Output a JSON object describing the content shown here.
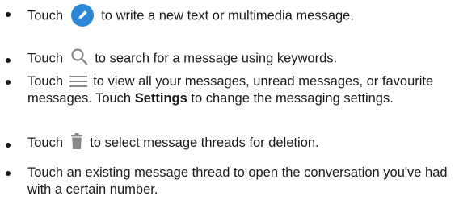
{
  "items": [
    {
      "prefix": "Touch",
      "icon": "compose-icon",
      "suffix": "to write a new text or multimedia message."
    },
    {
      "prefix": "Touch",
      "icon": "search-icon",
      "suffix": "to search for a message using keywords."
    },
    {
      "prefix": "Touch",
      "icon": "menu-icon",
      "suffix_a": "to view all your messages, unread messages, or favourite messages. Touch",
      "bold": "Settings",
      "suffix_b": "to change the messaging settings."
    },
    {
      "prefix": "Touch",
      "icon": "trash-icon",
      "suffix": "to select message threads for deletion."
    },
    {
      "text": "Touch an existing message thread to open the conversation you've had with a certain number."
    }
  ],
  "colors": {
    "accent": "#2e86d6",
    "icon_gray": "#8a8a8a",
    "text": "#1a1a1a"
  }
}
